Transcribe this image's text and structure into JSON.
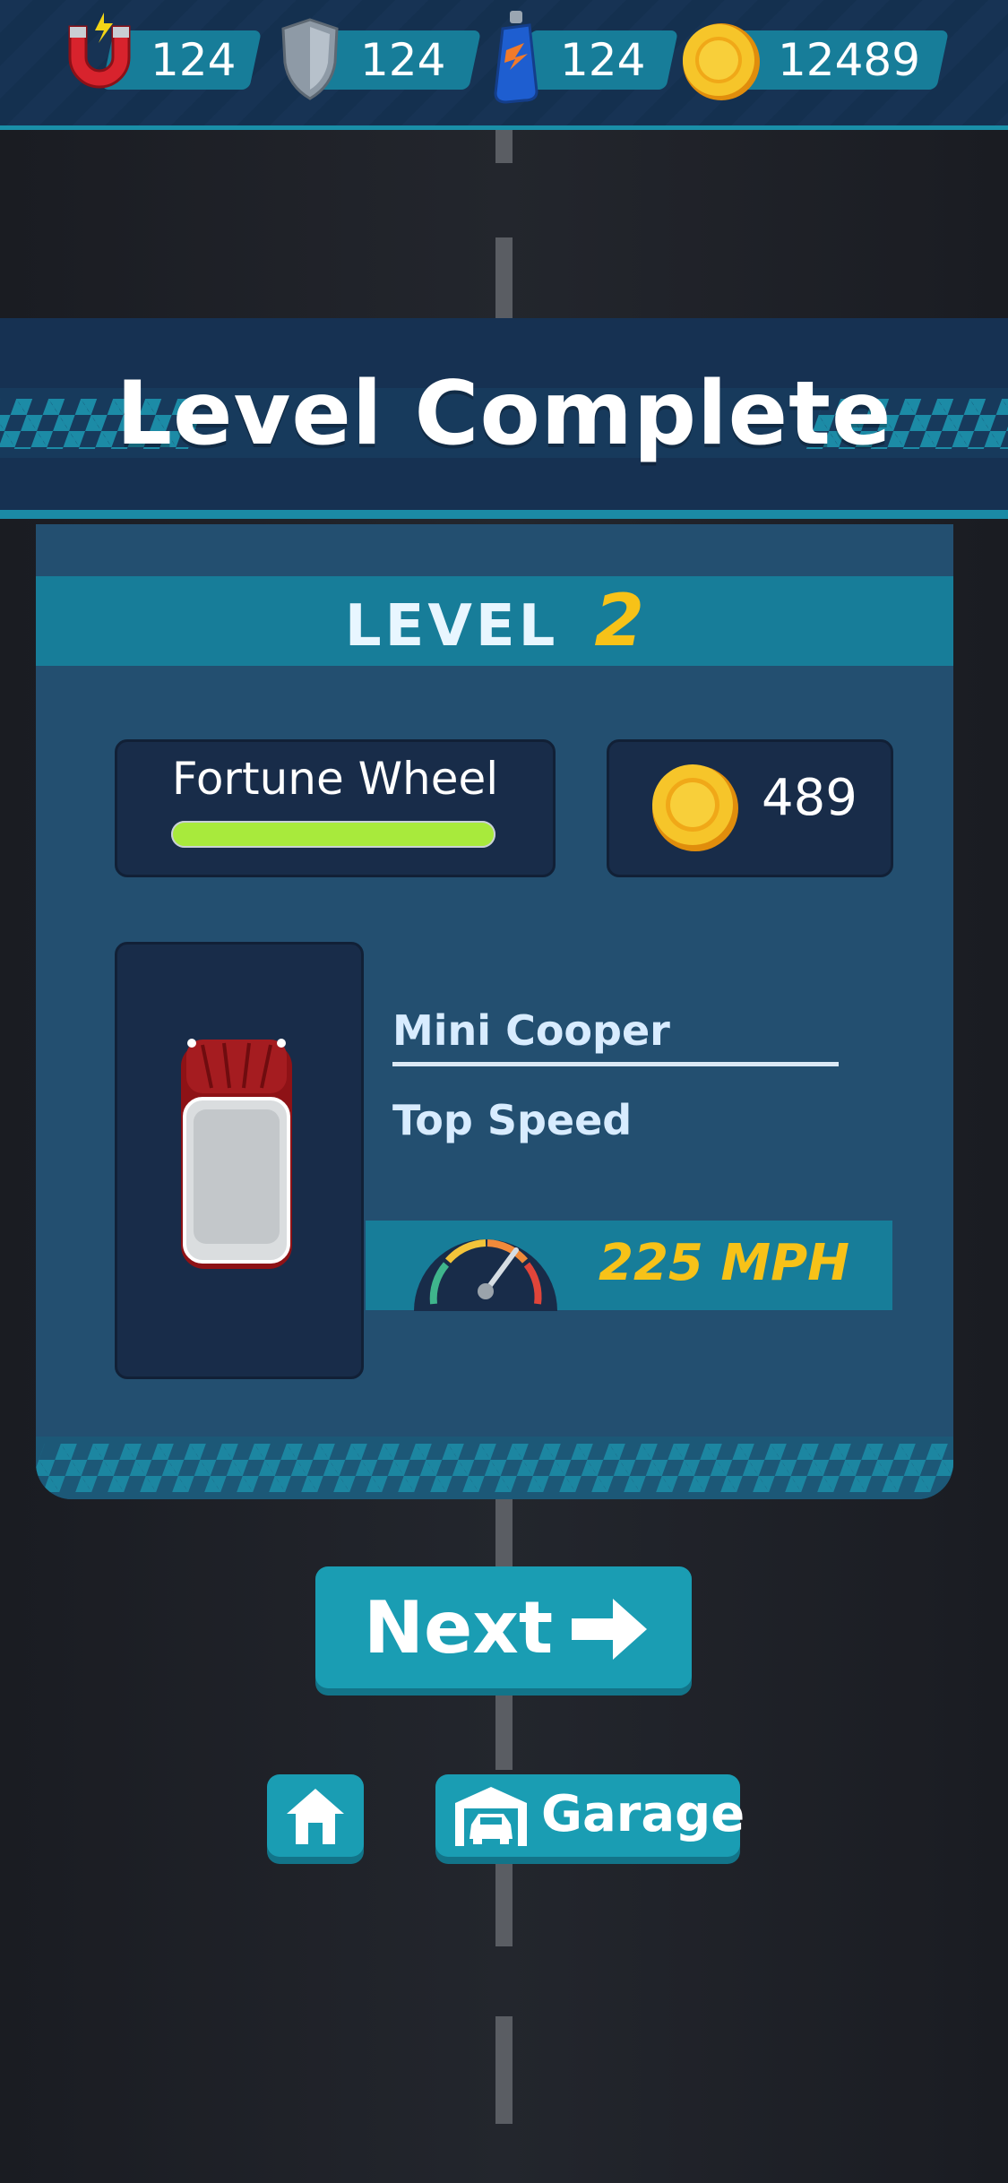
{
  "hud": {
    "magnet": {
      "icon": "magnet-icon",
      "count": "124"
    },
    "shield": {
      "icon": "shield-icon",
      "count": "124"
    },
    "nitro": {
      "icon": "nitro-bottle-icon",
      "count": "124"
    },
    "coins": {
      "icon": "coin-icon",
      "count": "12489"
    }
  },
  "banner": {
    "title": "Level Complete"
  },
  "level": {
    "word": "LEVEL",
    "number": "2"
  },
  "fortune_wheel": {
    "label": "Fortune Wheel",
    "progress": 1.0
  },
  "reward": {
    "icon": "coin-icon",
    "amount": "489"
  },
  "car": {
    "name": "Mini Cooper",
    "stat_label": "Top Speed",
    "speed": "225 MPH",
    "icon": "mini-cooper-car-icon"
  },
  "buttons": {
    "next_label": "Next",
    "garage_label": "Garage"
  },
  "colors": {
    "accent": "#1a9db3",
    "panel": "#234f70",
    "gold": "#f7c218",
    "progress": "#a8ea3c"
  }
}
